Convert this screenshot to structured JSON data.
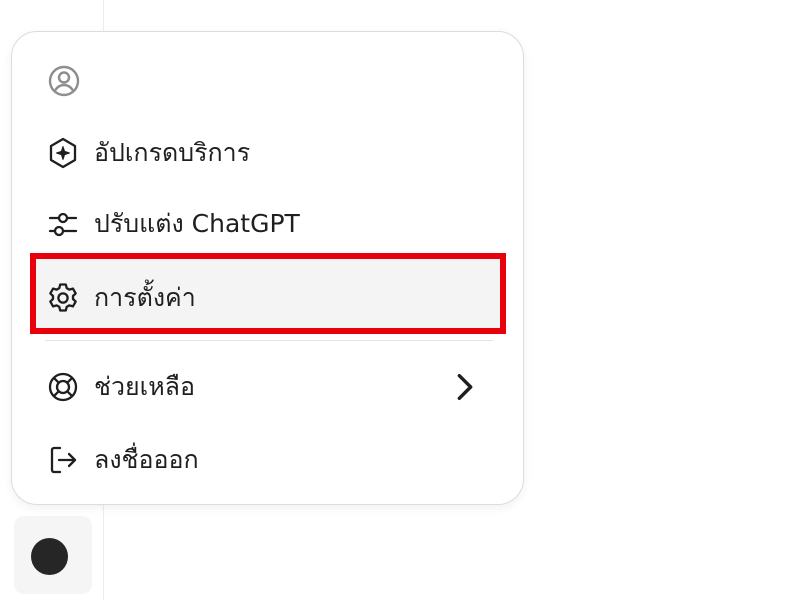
{
  "sidebar": {
    "avatar_color": "#262626"
  },
  "menu": {
    "profile_icon": "user-circle-icon",
    "items": [
      {
        "label": "อัปเกรดบริการ",
        "icon": "sparkle-hexagon-icon"
      },
      {
        "label": "ปรับแต่ง ChatGPT",
        "icon": "sliders-icon"
      },
      {
        "label": "การตั้งค่า",
        "icon": "gear-icon",
        "highlighted": true
      },
      {
        "label": "ช่วยเหลือ",
        "icon": "lifebuoy-icon",
        "submenu": true
      },
      {
        "label": "ลงชื่อออก",
        "icon": "logout-icon"
      }
    ],
    "highlight_color": "#e8000b"
  }
}
